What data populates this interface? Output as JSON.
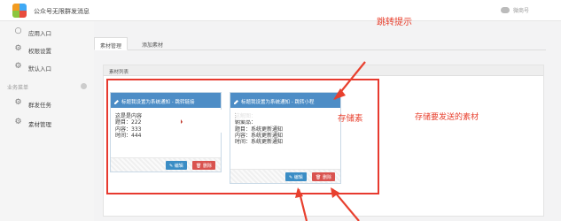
{
  "header": {
    "title": "公众号无限群发消息",
    "account_name": "微商号"
  },
  "sidebar": {
    "items": [
      {
        "label": "应用入口",
        "icon": "chat-bubble-icon"
      },
      {
        "label": "权限设置",
        "icon": "gear-icon"
      },
      {
        "label": "默认入口",
        "icon": "gear-icon"
      }
    ],
    "section_label": "业务菜单",
    "section_items": [
      {
        "label": "群发任务",
        "icon": "gear-icon"
      },
      {
        "label": "素材管理",
        "icon": "gear-icon"
      }
    ]
  },
  "tabs": [
    {
      "label": "素材管理",
      "active": true
    },
    {
      "label": "添加素材",
      "active": false
    }
  ],
  "panel": {
    "heading": "素材列表"
  },
  "cards": [
    {
      "title": "标题我设置为系统通知 - 跳转链接",
      "lines": [
        "这是是内容",
        "题目：222",
        "内容：333",
        "时间：444"
      ],
      "edit_label": "编辑",
      "delete_label": "删除"
    },
    {
      "title": "标题我设置为系统通知 - 跳转小程",
      "lines": [
        "这解图：",
        "朝爱品：",
        "题目：系统更新通知",
        "内容：系统更新通知",
        "时间：系统更新通知"
      ],
      "edit_label": "编辑",
      "delete_label": "删除"
    }
  ],
  "annotations": {
    "jump_hint": "跳转提示",
    "store_material": "存储要发送的素材",
    "store_partial": "存储素"
  },
  "colors": {
    "card_header": "#4d8dc6",
    "edit_button": "#3b8dc5",
    "delete_button": "#d9534f",
    "annotation": "#e8402e"
  }
}
